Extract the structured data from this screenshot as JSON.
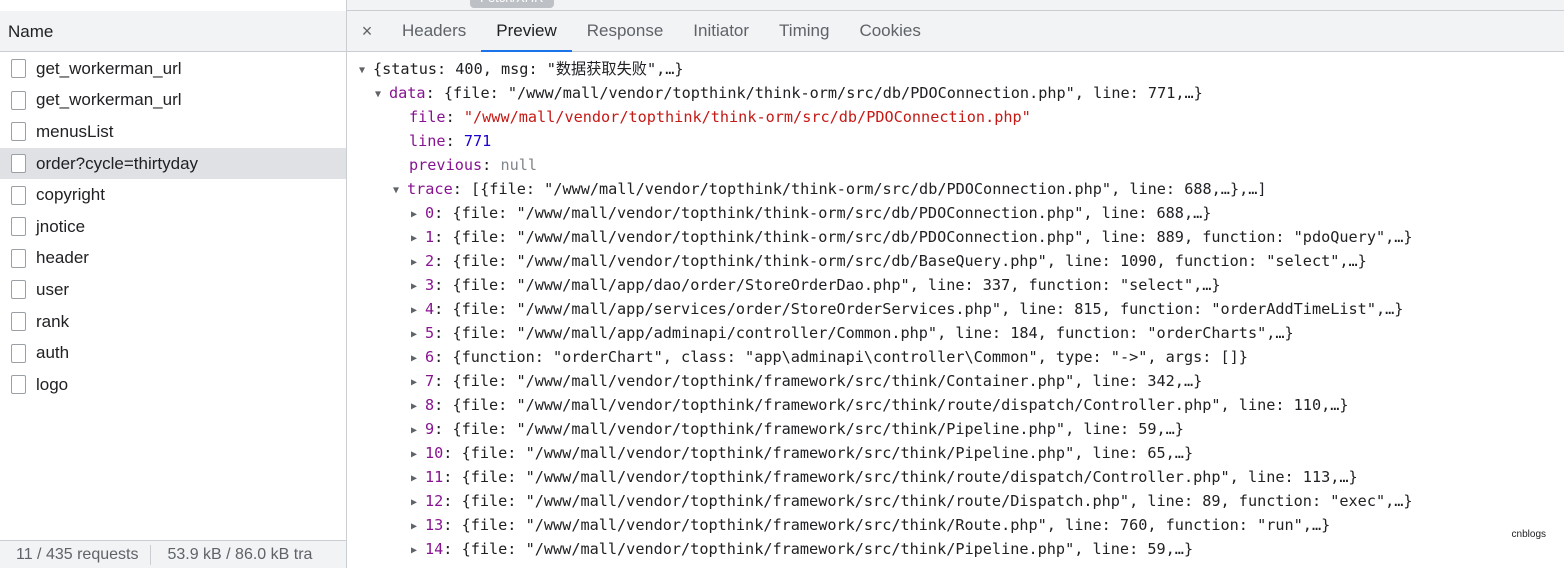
{
  "top_strip": {
    "chip_label": "Fetch/XHR"
  },
  "left_panel": {
    "header": "Name",
    "requests": [
      {
        "name": "get_workerman_url"
      },
      {
        "name": "get_workerman_url"
      },
      {
        "name": "menusList"
      },
      {
        "name": "order?cycle=thirtyday",
        "selected": true
      },
      {
        "name": "copyright"
      },
      {
        "name": "jnotice"
      },
      {
        "name": "header"
      },
      {
        "name": "user"
      },
      {
        "name": "rank"
      },
      {
        "name": "auth"
      },
      {
        "name": "logo"
      }
    ],
    "status": {
      "requests": "11 / 435 requests",
      "transfer": "53.9 kB / 86.0 kB tra"
    }
  },
  "tabs": {
    "close_symbol": "×",
    "items": [
      "Headers",
      "Preview",
      "Response",
      "Initiator",
      "Timing",
      "Cookies"
    ],
    "active": "Preview"
  },
  "preview": {
    "root_summary": "{status: 400, msg: \"数据获取失败\",…}",
    "data_key": "data",
    "data_summary": "{file: \"/www/mall/vendor/topthink/think-orm/src/db/PDOConnection.php\", line: 771,…}",
    "file_key": "file",
    "file_value": "\"/www/mall/vendor/topthink/think-orm/src/db/PDOConnection.php\"",
    "line_key": "line",
    "line_value": "771",
    "previous_key": "previous",
    "previous_value": "null",
    "trace_key": "trace",
    "trace_summary": "[{file: \"/www/mall/vendor/topthink/think-orm/src/db/PDOConnection.php\", line: 688,…},…]",
    "trace_items": [
      {
        "idx": "0",
        "text": "{file: \"/www/mall/vendor/topthink/think-orm/src/db/PDOConnection.php\", line: 688,…}"
      },
      {
        "idx": "1",
        "text": "{file: \"/www/mall/vendor/topthink/think-orm/src/db/PDOConnection.php\", line: 889, function: \"pdoQuery\",…}"
      },
      {
        "idx": "2",
        "text": "{file: \"/www/mall/vendor/topthink/think-orm/src/db/BaseQuery.php\", line: 1090, function: \"select\",…}"
      },
      {
        "idx": "3",
        "text": "{file: \"/www/mall/app/dao/order/StoreOrderDao.php\", line: 337, function: \"select\",…}"
      },
      {
        "idx": "4",
        "text": "{file: \"/www/mall/app/services/order/StoreOrderServices.php\", line: 815, function: \"orderAddTimeList\",…}"
      },
      {
        "idx": "5",
        "text": "{file: \"/www/mall/app/adminapi/controller/Common.php\", line: 184, function: \"orderCharts\",…}"
      },
      {
        "idx": "6",
        "text": "{function: \"orderChart\", class: \"app\\adminapi\\controller\\Common\", type: \"->\", args: []}"
      },
      {
        "idx": "7",
        "text": "{file: \"/www/mall/vendor/topthink/framework/src/think/Container.php\", line: 342,…}"
      },
      {
        "idx": "8",
        "text": "{file: \"/www/mall/vendor/topthink/framework/src/think/route/dispatch/Controller.php\", line: 110,…}"
      },
      {
        "idx": "9",
        "text": "{file: \"/www/mall/vendor/topthink/framework/src/think/Pipeline.php\", line: 59,…}"
      },
      {
        "idx": "10",
        "text": "{file: \"/www/mall/vendor/topthink/framework/src/think/Pipeline.php\", line: 65,…}"
      },
      {
        "idx": "11",
        "text": "{file: \"/www/mall/vendor/topthink/framework/src/think/route/dispatch/Controller.php\", line: 113,…}"
      },
      {
        "idx": "12",
        "text": "{file: \"/www/mall/vendor/topthink/framework/src/think/route/Dispatch.php\", line: 89, function: \"exec\",…}"
      },
      {
        "idx": "13",
        "text": "{file: \"/www/mall/vendor/topthink/framework/src/think/Route.php\", line: 760, function: \"run\",…}"
      },
      {
        "idx": "14",
        "text": "{file: \"/www/mall/vendor/topthink/framework/src/think/Pipeline.php\", line: 59,…}"
      }
    ]
  },
  "watermark": "cnblogs",
  "colors": {
    "key": "#881391",
    "string": "#c41a16",
    "number": "#1c00cf",
    "active_tab": "#1a73e8"
  }
}
